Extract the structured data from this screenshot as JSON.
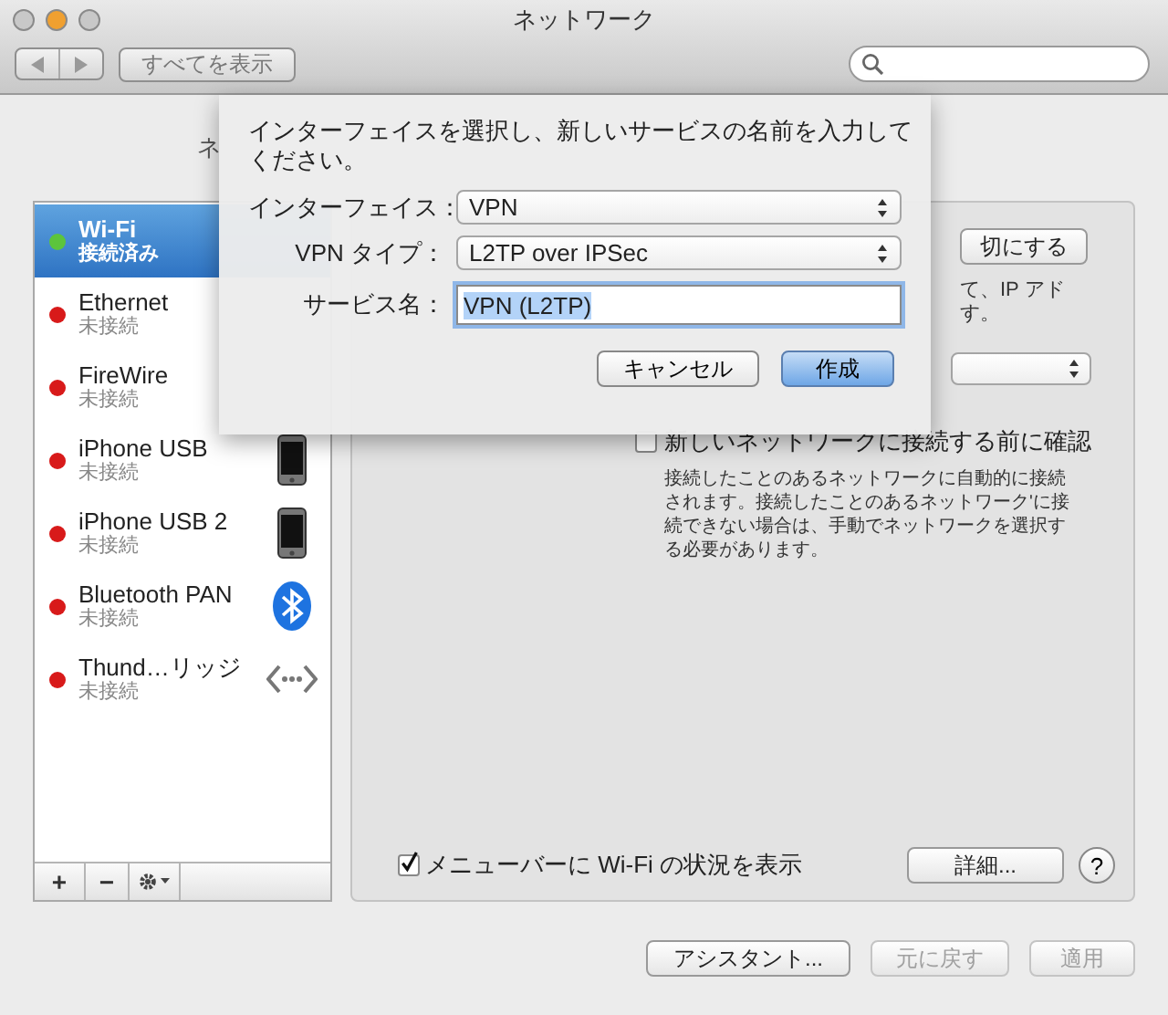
{
  "window": {
    "title": "ネットワーク",
    "buttons": [
      {
        "color": "#c8c8c8"
      },
      {
        "color": "#f0a030"
      },
      {
        "color": "#c8c8c8"
      }
    ]
  },
  "toolbar": {
    "show_all": "すべてを表示"
  },
  "location_label": "ネ",
  "sidebar": {
    "items": [
      {
        "name": "Wi-Fi",
        "status": "接続済み",
        "color": "#5cc43c",
        "kind": "wifi",
        "selected": true
      },
      {
        "name": "Ethernet",
        "status": "未接続",
        "color": "#d81a1a",
        "kind": "ethernet",
        "selected": false
      },
      {
        "name": "FireWire",
        "status": "未接続",
        "color": "#d81a1a",
        "kind": "firewire",
        "selected": false
      },
      {
        "name": "iPhone USB",
        "status": "未接続",
        "color": "#d81a1a",
        "kind": "phone",
        "selected": false
      },
      {
        "name": "iPhone USB 2",
        "status": "未接続",
        "color": "#d81a1a",
        "kind": "phone",
        "selected": false
      },
      {
        "name": "Bluetooth PAN",
        "status": "未接続",
        "color": "#d81a1a",
        "kind": "bluetooth",
        "selected": false
      },
      {
        "name": "Thund…リッジ",
        "status": "未接続",
        "color": "#d81a1a",
        "kind": "bridge",
        "selected": false
      }
    ],
    "add": "+",
    "remove": "−"
  },
  "panel": {
    "power_button": "切にする",
    "note_lines": [
      "て、IP アド",
      "す。"
    ],
    "ask_checkbox": {
      "label": "新しいネットワークに接続する前に確認",
      "checked": false
    },
    "ask_description": "接続したことのあるネットワークに自動的に接続されます。接続したことのあるネットワーク'に接続できない場合は、手動でネットワークを選択する必要があります。",
    "menubar_checkbox": {
      "label": "メニューバーに Wi-Fi の状況を表示",
      "checked": true
    },
    "advanced_button": "詳細...",
    "help": "?"
  },
  "footer": {
    "buttons": [
      {
        "label": "アシスタント...",
        "disabled": false
      },
      {
        "label": "元に戻す",
        "disabled": true
      },
      {
        "label": "適用",
        "disabled": true
      }
    ]
  },
  "sheet": {
    "message": "インターフェイスを選択し、新しいサービスの名前を入力してください。",
    "fields": [
      {
        "label": "インターフェイス：",
        "value": "VPN",
        "kind": "popup"
      },
      {
        "label": "VPN タイプ：",
        "value": "L2TP over IPSec",
        "kind": "popup"
      },
      {
        "label": "サービス名：",
        "value": "VPN (L2TP)",
        "kind": "text"
      }
    ],
    "buttons": [
      {
        "label": "キャンセル",
        "default": false
      },
      {
        "label": "作成",
        "default": true
      }
    ]
  }
}
